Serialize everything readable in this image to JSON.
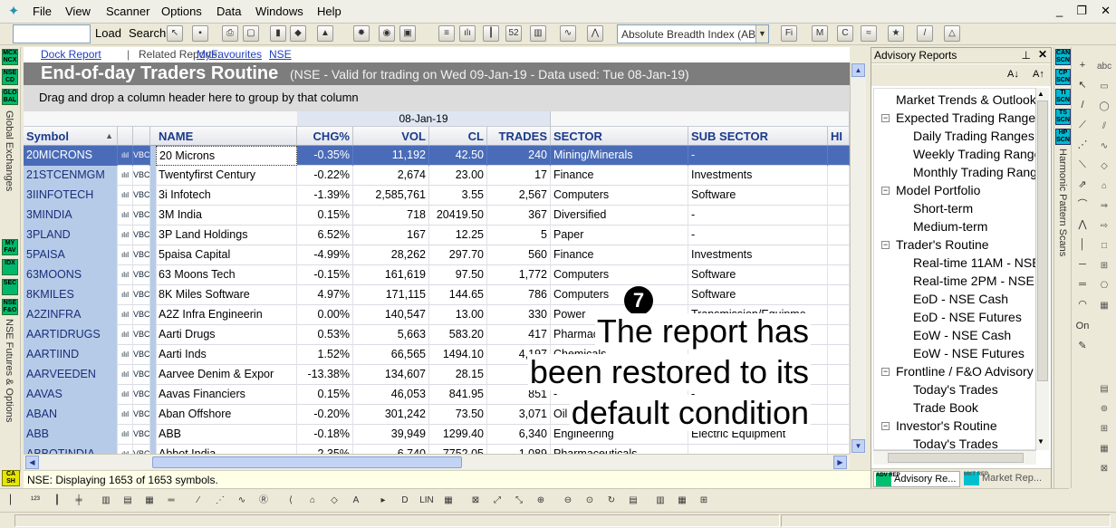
{
  "menubar": {
    "items": [
      "File",
      "View",
      "Scanner",
      "Options",
      "Data",
      "Windows",
      "Help"
    ],
    "window_controls": [
      "_",
      "❐",
      "✕"
    ]
  },
  "toolbar": {
    "load_label": "Load",
    "search_label": "Search",
    "indicator_combo": "Absolute Breadth Index (ABI"
  },
  "left_strip": {
    "buttons_top": [
      "MCX\nNCX",
      "NSE\nCD",
      "GLO\nBAL"
    ],
    "global_exchanges_label": "Global Exchanges",
    "buttons_mid": [
      "MY\nFAV",
      "IDX",
      "SEC",
      "NSE\nF&O"
    ],
    "nse_fo_label": "NSE Futures & Options"
  },
  "related": {
    "dock_report": "Dock Report",
    "separator": "|",
    "related_label": "Related Reports:",
    "myfavourites": "MyFavourites",
    "nse": "NSE"
  },
  "report": {
    "title": "End-of-day Traders Routine",
    "subtitle": "(NSE - Valid for trading on Wed 09-Jan-19 - Data used: Tue 08-Jan-19)",
    "group_hint": "Drag and drop a column header here to group by that column",
    "date_band": "08-Jan-19",
    "columns": {
      "symbol": "Symbol",
      "name": "NAME",
      "chg": "CHG%",
      "vol": "VOL",
      "cl": "CL",
      "trades": "TRADES",
      "sector": "SECTOR",
      "sub_sector": "SUB SECTOR",
      "hi": "HI"
    },
    "chart_glyph": "ılıl",
    "vbc_glyph": "VBC",
    "rows": [
      {
        "symbol": "20MICRONS",
        "name": "20 Microns",
        "chg": "-0.35%",
        "vol": "11,192",
        "cl": "42.50",
        "trades": "240",
        "sector": "Mining/Minerals",
        "sub": "-"
      },
      {
        "symbol": "21STCENMGM",
        "name": "Twentyfirst Century",
        "chg": "-0.22%",
        "vol": "2,674",
        "cl": "23.00",
        "trades": "17",
        "sector": "Finance",
        "sub": "Investments"
      },
      {
        "symbol": "3IINFOTECH",
        "name": "3i Infotech",
        "chg": "-1.39%",
        "vol": "2,585,761",
        "cl": "3.55",
        "trades": "2,567",
        "sector": "Computers",
        "sub": "Software"
      },
      {
        "symbol": "3MINDIA",
        "name": "3M India",
        "chg": "0.15%",
        "vol": "718",
        "cl": "20419.50",
        "trades": "367",
        "sector": "Diversified",
        "sub": "-"
      },
      {
        "symbol": "3PLAND",
        "name": "3P Land Holdings",
        "chg": "6.52%",
        "vol": "167",
        "cl": "12.25",
        "trades": "5",
        "sector": "Paper",
        "sub": "-"
      },
      {
        "symbol": "5PAISA",
        "name": "5paisa Capital",
        "chg": "-4.99%",
        "vol": "28,262",
        "cl": "297.70",
        "trades": "560",
        "sector": "Finance",
        "sub": "Investments"
      },
      {
        "symbol": "63MOONS",
        "name": "63 Moons Tech",
        "chg": "-0.15%",
        "vol": "161,619",
        "cl": "97.50",
        "trades": "1,772",
        "sector": "Computers",
        "sub": "Software"
      },
      {
        "symbol": "8KMILES",
        "name": "8K Miles Software",
        "chg": "4.97%",
        "vol": "171,115",
        "cl": "144.65",
        "trades": "786",
        "sector": "Computers",
        "sub": "Software"
      },
      {
        "symbol": "A2ZINFRA",
        "name": "A2Z Infra Engineerin",
        "chg": "0.00%",
        "vol": "140,547",
        "cl": "13.00",
        "trades": "330",
        "sector": "Power",
        "sub": "Transmission/Equipme"
      },
      {
        "symbol": "AARTIDRUGS",
        "name": "Aarti Drugs",
        "chg": "0.53%",
        "vol": "5,663",
        "cl": "583.20",
        "trades": "417",
        "sector": "Pharmaceuticals",
        "sub": ""
      },
      {
        "symbol": "AARTIIND",
        "name": "Aarti Inds",
        "chg": "1.52%",
        "vol": "66,565",
        "cl": "1494.10",
        "trades": "4,197",
        "sector": "Chemicals",
        "sub": ""
      },
      {
        "symbol": "AARVEEDEN",
        "name": "Aarvee Denim & Expor",
        "chg": "-13.38%",
        "vol": "134,607",
        "cl": "28.15",
        "trades": "1",
        "sector": "",
        "sub": ""
      },
      {
        "symbol": "AAVAS",
        "name": "Aavas Financiers",
        "chg": "0.15%",
        "vol": "46,053",
        "cl": "841.95",
        "trades": "851",
        "sector": "-",
        "sub": "-"
      },
      {
        "symbol": "ABAN",
        "name": "Aban Offshore",
        "chg": "-0.20%",
        "vol": "301,242",
        "cl": "73.50",
        "trades": "3,071",
        "sector": "Oil",
        "sub": ""
      },
      {
        "symbol": "ABB",
        "name": "ABB",
        "chg": "-0.18%",
        "vol": "39,949",
        "cl": "1299.40",
        "trades": "6,340",
        "sector": "Engineering",
        "sub": "Electric Equipment"
      },
      {
        "symbol": "ABBOTINDIA",
        "name": "Abbot India",
        "chg": "2.35%",
        "vol": "6,740",
        "cl": "7752.05",
        "trades": "1,089",
        "sector": "Pharmaceuticals",
        "sub": "-"
      }
    ]
  },
  "status": {
    "message": "NSE: Displaying 1653 of 1653 symbols.",
    "corner_button": "CA\nSH"
  },
  "advisory": {
    "title": "Advisory Reports",
    "pin": "⊥",
    "close": "✕",
    "font_smaller": "A↓",
    "font_larger": "A↑",
    "tree": [
      {
        "label": "Market Trends & Outlook",
        "level": 0,
        "box": ""
      },
      {
        "label": "Expected Trading Ranges",
        "level": 0,
        "box": "−"
      },
      {
        "label": "Daily Trading Ranges",
        "level": 1,
        "box": ""
      },
      {
        "label": "Weekly Trading Ranges",
        "level": 1,
        "box": ""
      },
      {
        "label": "Monthly Trading Ranges",
        "level": 1,
        "box": ""
      },
      {
        "label": "Model Portfolio",
        "level": 0,
        "box": "−"
      },
      {
        "label": "Short-term",
        "level": 1,
        "box": ""
      },
      {
        "label": "Medium-term",
        "level": 1,
        "box": ""
      },
      {
        "label": "Trader's Routine",
        "level": 0,
        "box": "−"
      },
      {
        "label": "Real-time 11AM - NSE",
        "level": 1,
        "box": ""
      },
      {
        "label": "Real-time 2PM - NSE",
        "level": 1,
        "box": ""
      },
      {
        "label": "EoD - NSE Cash",
        "level": 1,
        "box": ""
      },
      {
        "label": "EoD - NSE Futures",
        "level": 1,
        "box": ""
      },
      {
        "label": "EoW - NSE Cash",
        "level": 1,
        "box": ""
      },
      {
        "label": "EoW - NSE Futures",
        "level": 1,
        "box": ""
      },
      {
        "label": "Frontline / F&O Advisory",
        "level": 0,
        "box": "−"
      },
      {
        "label": "Today's Trades",
        "level": 1,
        "box": ""
      },
      {
        "label": "Trade Book",
        "level": 1,
        "box": ""
      },
      {
        "label": "Investor's Routine",
        "level": 0,
        "box": "−"
      },
      {
        "label": "Today's Trades",
        "level": 1,
        "box": ""
      }
    ],
    "tabs": [
      {
        "icon": "ADV\nREP",
        "label": "Advisory Re..."
      },
      {
        "icon": "MKT\nREP",
        "label": "Market Rep..."
      }
    ]
  },
  "right_strip": {
    "buttons": [
      "CAN\nSCN",
      "CP\nSCN",
      "TI\nSCN",
      "TS\nSCN",
      "HP\nSCN"
    ],
    "harmonic_label": "Harmonic Pattern Scans"
  },
  "overlay": {
    "badge": "7",
    "line1": "The report has",
    "line2": "been restored to its",
    "line3": "default condition"
  },
  "colors": {
    "selection": "#4a6cb8",
    "symbol_column": "#b6cbe7",
    "header_text": "#1a3a8a",
    "title_bar": "#7d7d7d"
  }
}
